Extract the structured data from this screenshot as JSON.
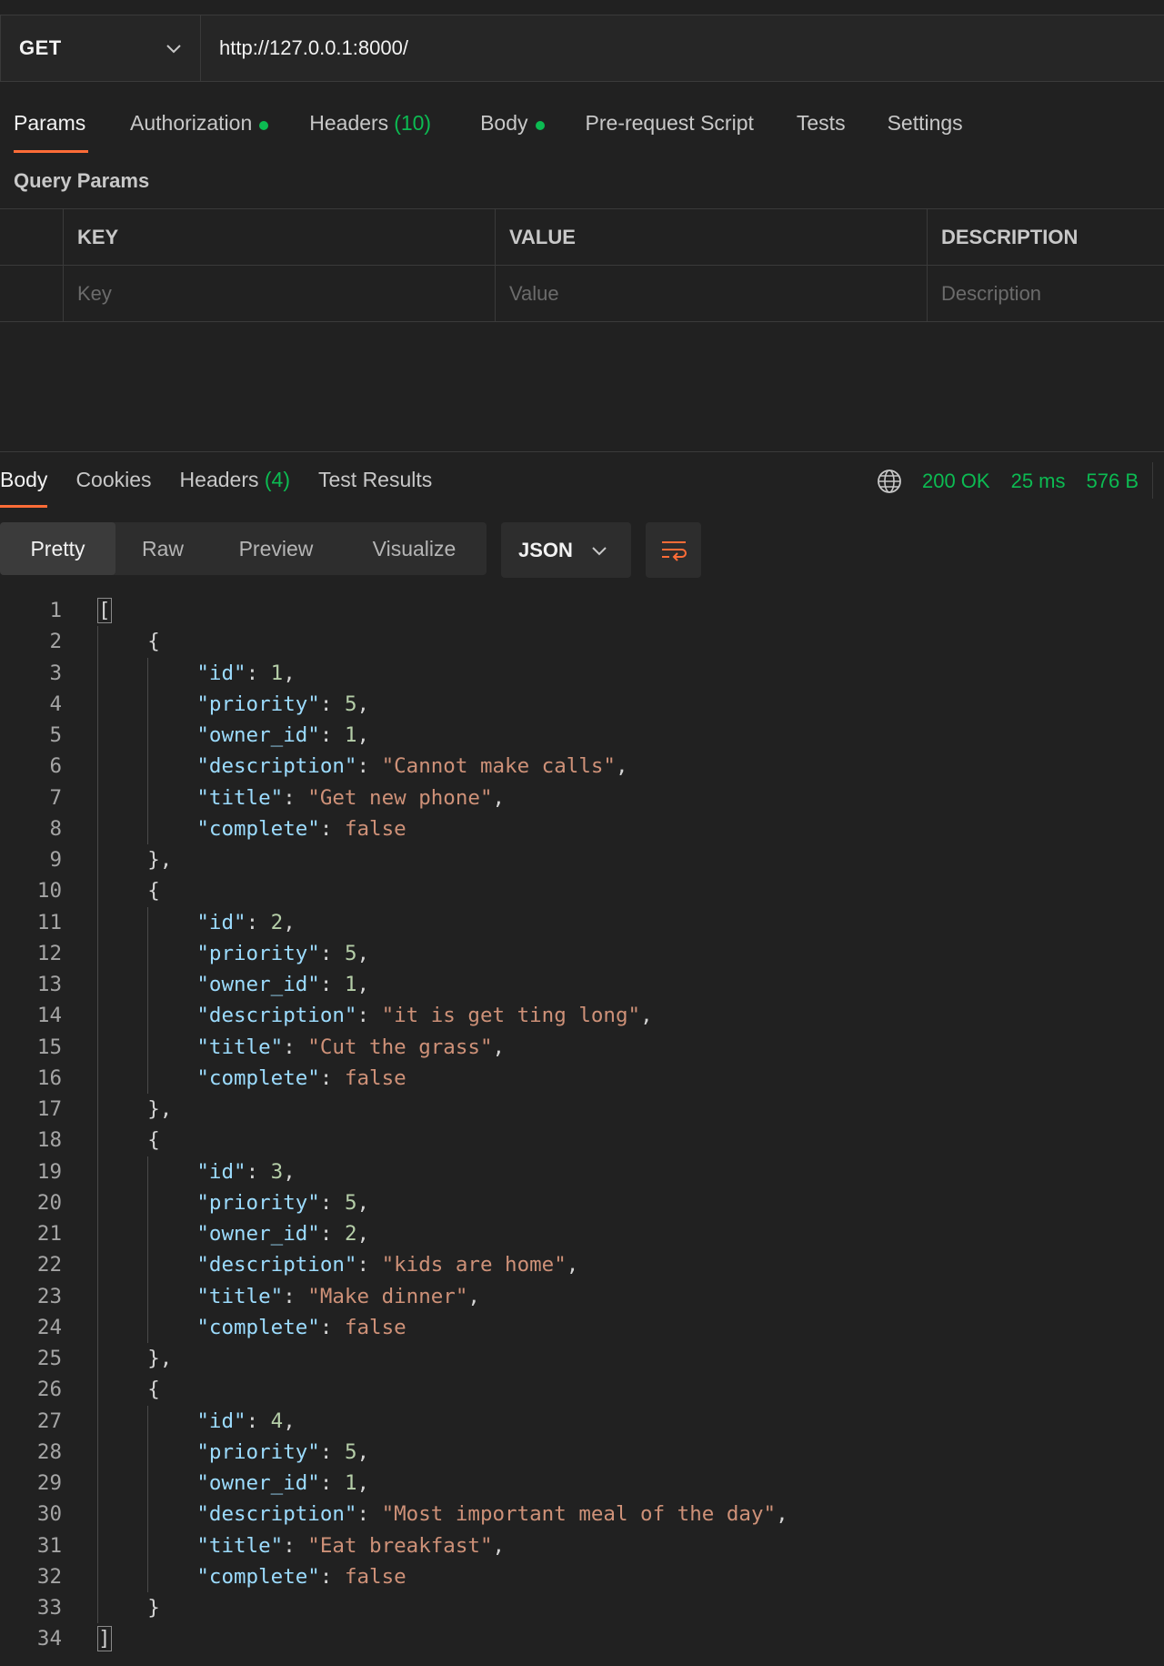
{
  "request": {
    "method": "GET",
    "url": "http://127.0.0.1:8000/"
  },
  "request_tabs": [
    {
      "label": "Params",
      "active": true
    },
    {
      "label": "Authorization",
      "dot": true
    },
    {
      "label": "Headers",
      "count": "(10)"
    },
    {
      "label": "Body",
      "dot": true
    },
    {
      "label": "Pre-request Script"
    },
    {
      "label": "Tests"
    },
    {
      "label": "Settings"
    }
  ],
  "query_params": {
    "title": "Query Params",
    "headers": {
      "key": "KEY",
      "value": "VALUE",
      "description": "DESCRIPTION"
    },
    "placeholders": {
      "key": "Key",
      "value": "Value",
      "description": "Description"
    }
  },
  "response_tabs": [
    {
      "label": "Body",
      "active": true
    },
    {
      "label": "Cookies"
    },
    {
      "label": "Headers",
      "count": "(4)"
    },
    {
      "label": "Test Results"
    }
  ],
  "response_status": {
    "status": "200 OK",
    "time": "25 ms",
    "size": "576 B"
  },
  "format_buttons": [
    {
      "label": "Pretty",
      "active": true
    },
    {
      "label": "Raw"
    },
    {
      "label": "Preview"
    },
    {
      "label": "Visualize"
    }
  ],
  "language": "JSON",
  "icons": {
    "method_chevron": "chevron-down-icon",
    "globe": "globe-icon",
    "lang_chevron": "chevron-down-icon",
    "wrap": "wrap-lines-icon"
  },
  "colors": {
    "accent": "#ff6c37",
    "success": "#0cbb52",
    "background": "#212121"
  },
  "response_body": [
    {
      "id": 1,
      "priority": 5,
      "owner_id": 1,
      "description": "Cannot make calls",
      "title": "Get new phone",
      "complete": false
    },
    {
      "id": 2,
      "priority": 5,
      "owner_id": 1,
      "description": "it is get ting long",
      "title": "Cut the grass",
      "complete": false
    },
    {
      "id": 3,
      "priority": 5,
      "owner_id": 2,
      "description": "kids are home",
      "title": "Make dinner",
      "complete": false
    },
    {
      "id": 4,
      "priority": 5,
      "owner_id": 1,
      "description": "Most important meal of the day",
      "title": "Eat breakfast",
      "complete": false
    }
  ]
}
